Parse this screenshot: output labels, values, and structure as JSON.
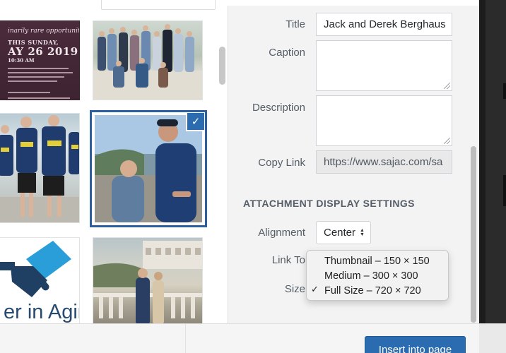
{
  "grid": {
    "flyer": {
      "line1": "inarily rare opportunity!",
      "line2": "THIS SUNDAY,",
      "line3": "AY 26 2019",
      "line4": "10:30 AM"
    },
    "logo_text": "er in Agin"
  },
  "details": {
    "title_label": "Title",
    "title_value": "Jack and Derek Berghaus",
    "caption_label": "Caption",
    "caption_value": "",
    "description_label": "Description",
    "description_value": "",
    "copy_link_label": "Copy Link",
    "copy_link_value": "https://www.sajac.com/sa"
  },
  "display_settings": {
    "heading": "ATTACHMENT DISPLAY SETTINGS",
    "alignment_label": "Alignment",
    "alignment_value": "Center",
    "link_to_label": "Link To",
    "size_label": "Size",
    "size_options": [
      {
        "label": "Thumbnail – 150 × 150",
        "selected": false
      },
      {
        "label": "Medium – 300 × 300",
        "selected": false
      },
      {
        "label": "Full Size – 720 × 720",
        "selected": true
      }
    ]
  },
  "footer": {
    "insert_button": "Insert into page"
  },
  "colors": {
    "accent": "#2b6cb0",
    "sidebar_bg": "#f3f3f3",
    "selection_border": "#2b5f9e"
  }
}
